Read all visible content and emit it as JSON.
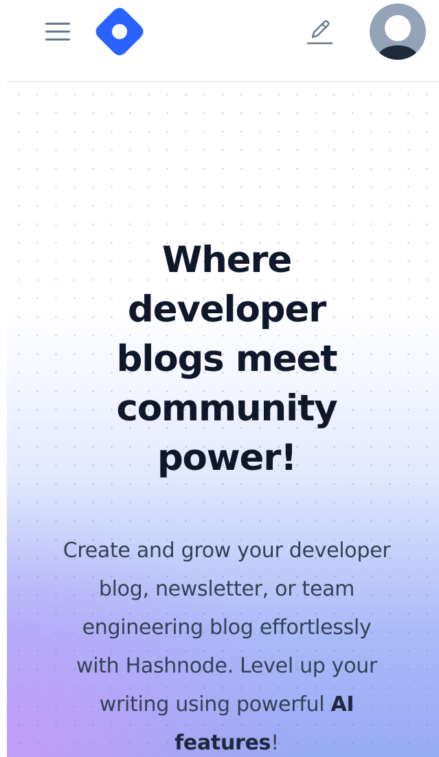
{
  "header": {
    "menu_icon": "hamburger-menu-icon",
    "logo_icon": "hashnode-logo-icon",
    "write_icon": "pencil-icon",
    "avatar_icon": "user-avatar-icon"
  },
  "hero": {
    "title": "Where developer blogs meet community power!",
    "description_prefix": "Create and grow your developer blog, newsletter, or team engineering blog effortlessly with Hashnode. Level up your writing using powerful ",
    "description_highlight": "AI features",
    "description_suffix": "!"
  },
  "colors": {
    "brand": "#2962ff",
    "title_text": "#0f172a",
    "body_text": "#334155",
    "icon_gray": "#64748b",
    "avatar_bg": "#94a3b8",
    "avatar_figure": "#1e293b"
  }
}
